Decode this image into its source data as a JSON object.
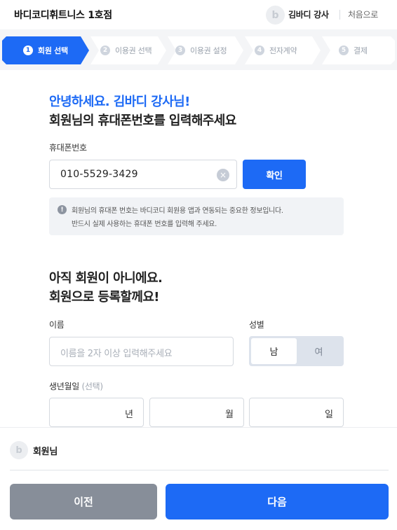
{
  "header": {
    "title": "바디코디휘트니스 1호점",
    "avatar_letter": "b",
    "user_name": "김바디 강사",
    "home_link": "처음으로"
  },
  "steps": [
    {
      "num": "1",
      "label": "회원 선택",
      "active": true
    },
    {
      "num": "2",
      "label": "이용권 선택",
      "active": false
    },
    {
      "num": "3",
      "label": "이용권 설정",
      "active": false
    },
    {
      "num": "4",
      "label": "전자계약",
      "active": false
    },
    {
      "num": "5",
      "label": "결제",
      "active": false
    }
  ],
  "colors": {
    "accent": "#1d6af5",
    "step_idle": "#ffffff",
    "prev_button": "#878e99"
  },
  "lookup": {
    "greeting": "안녕하세요. 김바디 강사님!",
    "instruction": "회원님의 휴대폰번호를 입력해주세요",
    "phone_label": "휴대폰번호",
    "phone_value": "010-5529-3429",
    "clear_icon": "×",
    "confirm_label": "확인",
    "notice_icon": "!",
    "notice_line1": "회원님의 휴대폰 번호는 바디코디 회원용 앱과 연동되는 중요한 정보입니다.",
    "notice_line2": "반드시 실제 사용하는 휴대폰 번호를 입력해 주세요."
  },
  "register": {
    "heading_line1": "아직 회원이 아니에요.",
    "heading_line2": "회원으로 등록할께요!",
    "name_label": "이름",
    "name_placeholder": "이름을 2자 이상 입력해주세요",
    "gender_label": "성별",
    "gender_male": "남",
    "gender_female": "여",
    "gender_selected": "남",
    "birth_label": "생년월일",
    "birth_optional": "(선택)",
    "birth_year_unit": "년",
    "birth_month_unit": "월",
    "birth_day_unit": "일"
  },
  "bottom": {
    "avatar_letter": "b",
    "member_label": "회원님",
    "prev_label": "이전",
    "next_label": "다음"
  }
}
